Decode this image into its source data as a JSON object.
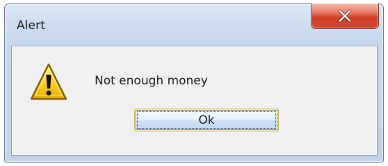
{
  "window": {
    "title": "Alert"
  },
  "titlebar": {
    "close_icon": "close-icon",
    "close_color": "#cf3c25"
  },
  "dialog": {
    "icon": "warning-icon",
    "message": "Not enough money",
    "ok_label": "Ok"
  },
  "colors": {
    "frame": "#c6d7ec",
    "client": "#f0f0f0",
    "warning": "#f2c400",
    "focus_border": "#c8b453"
  }
}
